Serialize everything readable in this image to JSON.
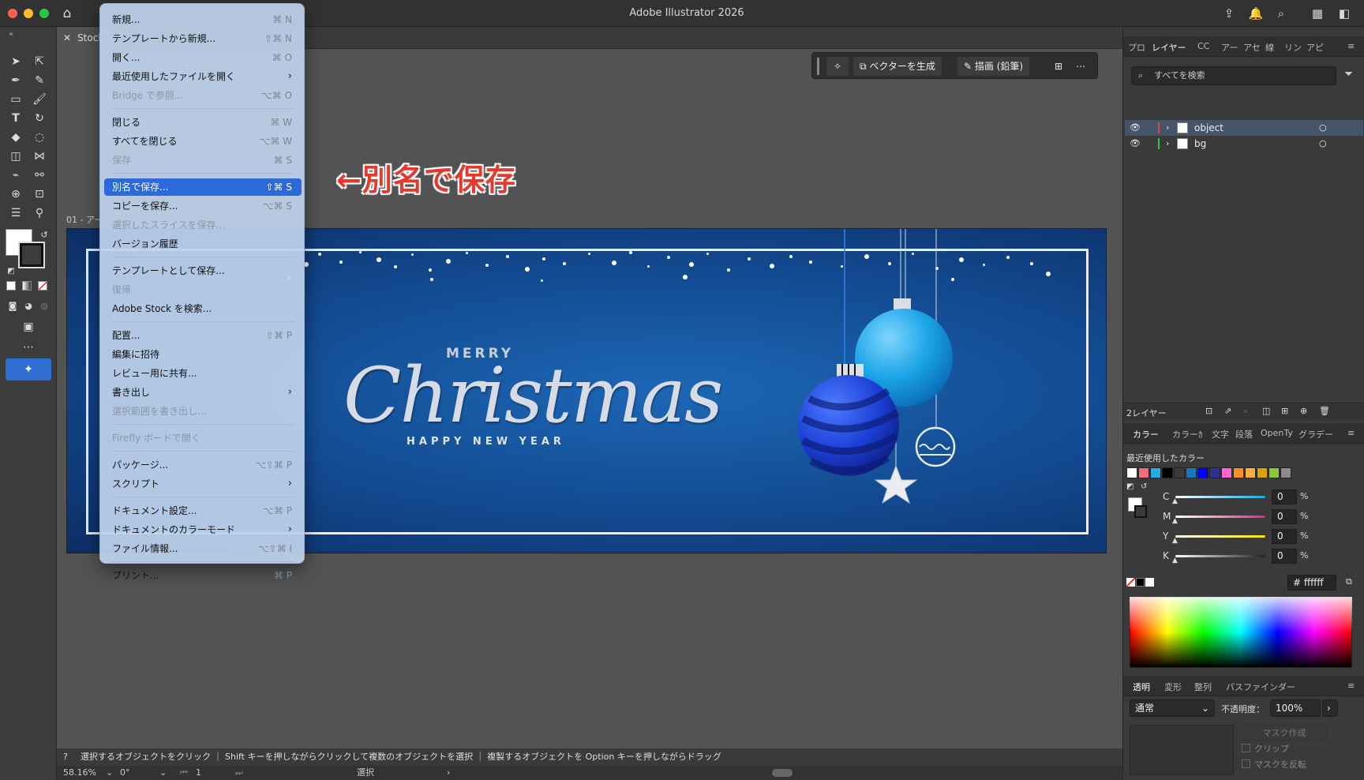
{
  "app": {
    "title": "Adobe Illustrator 2026"
  },
  "document": {
    "tab_label": "Stock",
    "artboard_label": "01 - アー"
  },
  "context_bar": {
    "generate_vector": "ベクターを生成",
    "draw_pencil": "描画 (鉛筆)"
  },
  "file_menu": {
    "items": [
      {
        "label": "新規...",
        "shortcut": "⌘ N",
        "disabled": false
      },
      {
        "label": "テンプレートから新規...",
        "shortcut": "⇧⌘ N",
        "disabled": false
      },
      {
        "label": "開く...",
        "shortcut": "⌘ O",
        "disabled": false
      },
      {
        "label": "最近使用したファイルを開く",
        "shortcut": "›",
        "disabled": false
      },
      {
        "label": "Bridge で参照...",
        "shortcut": "⌥⌘ O",
        "disabled": true
      },
      {
        "label": "閉じる",
        "shortcut": "⌘ W",
        "disabled": false
      },
      {
        "label": "すべてを閉じる",
        "shortcut": "⌥⌘ W",
        "disabled": false
      },
      {
        "label": "保存",
        "shortcut": "⌘ S",
        "disabled": true
      },
      {
        "label": "別名で保存...",
        "shortcut": "⇧⌘ S",
        "disabled": false,
        "selected": true
      },
      {
        "label": "コピーを保存...",
        "shortcut": "⌥⌘ S",
        "disabled": false
      },
      {
        "label": "選択したスライスを保存...",
        "shortcut": "",
        "disabled": true
      },
      {
        "label": "バージョン履歴",
        "shortcut": "",
        "disabled": false
      },
      {
        "label": "テンプレートとして保存...",
        "shortcut": "",
        "disabled": false
      },
      {
        "label": "復帰",
        "shortcut": "",
        "disabled": true
      },
      {
        "label": "Adobe Stock を検索...",
        "shortcut": "",
        "disabled": false
      },
      {
        "label": "配置...",
        "shortcut": "⇧⌘ P",
        "disabled": false
      },
      {
        "label": "編集に招待",
        "shortcut": "",
        "disabled": false
      },
      {
        "label": "レビュー用に共有...",
        "shortcut": "",
        "disabled": false
      },
      {
        "label": "書き出し",
        "shortcut": "›",
        "disabled": false
      },
      {
        "label": "選択範囲を書き出し...",
        "shortcut": "",
        "disabled": true
      },
      {
        "label": "Firefly ボードで開く",
        "shortcut": "",
        "disabled": true
      },
      {
        "label": "パッケージ...",
        "shortcut": "⌥⇧⌘ P",
        "disabled": false
      },
      {
        "label": "スクリプト",
        "shortcut": "›",
        "disabled": false
      },
      {
        "label": "ドキュメント設定...",
        "shortcut": "⌥⌘ P",
        "disabled": false
      },
      {
        "label": "ドキュメントのカラーモード",
        "shortcut": "›",
        "disabled": false
      },
      {
        "label": "ファイル情報...",
        "shortcut": "⌥⇧⌘ I",
        "disabled": false
      },
      {
        "label": "プリント...",
        "shortcut": "⌘ P",
        "disabled": false
      }
    ]
  },
  "annotation": {
    "text": "←別名で保存"
  },
  "artwork": {
    "merry": "MERRY",
    "christmas": "Christmas",
    "happy": "HAPPY NEW YEAR"
  },
  "hint_bar": {
    "text": "選択するオブジェクトをクリック ｜ Shift キーを押しながらクリックして複数のオブジェクトを選択 ｜ 複製するオブジェクトを Option キーを押しながらドラッグ"
  },
  "status_bar": {
    "zoom": "58.16%",
    "rotation": "0°",
    "artboard_num": "1",
    "mode": "選択"
  },
  "panels": {
    "top_tabs": [
      "プロ",
      "レイヤー",
      "CC",
      "アー",
      "アセ",
      "線",
      "リン",
      "アピ"
    ],
    "layer_search_placeholder": "すべてを検索",
    "layers": [
      {
        "name": "object",
        "color": "#e8443a"
      },
      {
        "name": "bg",
        "color": "#2fc84a"
      }
    ],
    "layer_count": "2レイヤー",
    "color_tabs": [
      "カラー",
      "カラーｶ",
      "文字",
      "段落",
      "OpenTy",
      "グラデー"
    ],
    "recent_colors_label": "最近使用したカラー",
    "recent_colors": [
      "#ffffff",
      "#f26d7d",
      "#29abe2",
      "#000000",
      "#3a3a3a",
      "#1b75bc",
      "#0000ff",
      "#2e3192",
      "#ff66cc",
      "#f7931e",
      "#fbb03b",
      "#d9a400",
      "#8cc63f",
      "#8a8a8a"
    ],
    "cmyk": [
      {
        "label": "C",
        "value": "0",
        "unit": "%",
        "color": "#19a9e1"
      },
      {
        "label": "M",
        "value": "0",
        "unit": "%",
        "color": "#e42682"
      },
      {
        "label": "Y",
        "value": "0",
        "unit": "%",
        "color": "#f5e400"
      },
      {
        "label": "K",
        "value": "0",
        "unit": "%",
        "color": "#222222"
      }
    ],
    "hex_value": "ffffff",
    "transparency_tabs": [
      "透明",
      "変形",
      "整列",
      "パスファインダー"
    ],
    "blend_mode": "通常",
    "opacity_label": "不透明度：",
    "opacity_value": "100%",
    "mask_button": "マスク作成",
    "clip_label": "クリップ",
    "invert_label": "マスクを反転"
  }
}
